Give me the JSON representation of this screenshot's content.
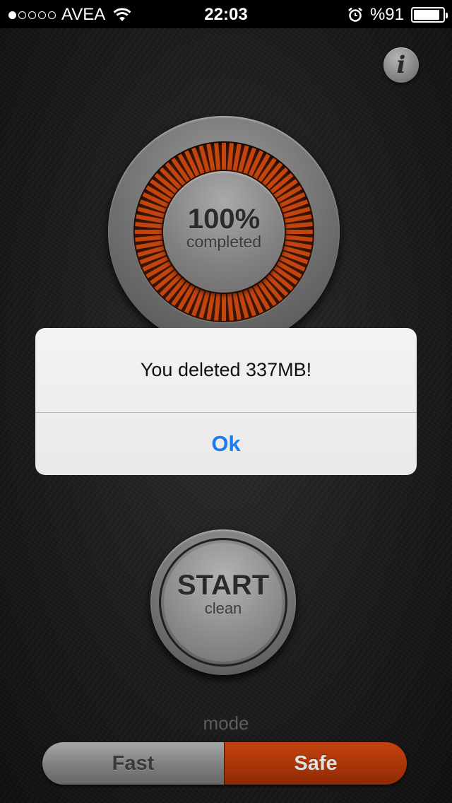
{
  "status_bar": {
    "signal_dots": [
      true,
      false,
      false,
      false,
      false
    ],
    "carrier": "AVEA",
    "time": "22:03",
    "battery": "%91",
    "battery_level": 0.91
  },
  "info_button": {
    "label": "i"
  },
  "progress": {
    "percent_text": "100%",
    "caption": "completed",
    "fraction": 1.0,
    "accent_color": "#c2440f"
  },
  "alert": {
    "message": "You deleted 337MB!",
    "ok_label": "Ok",
    "ok_color": "#1a7cf5"
  },
  "start_button": {
    "label": "START",
    "sublabel": "clean"
  },
  "mode": {
    "label": "mode",
    "options": [
      "Fast",
      "Safe"
    ],
    "selected": "Safe",
    "selected_color": "#b43a0a"
  }
}
